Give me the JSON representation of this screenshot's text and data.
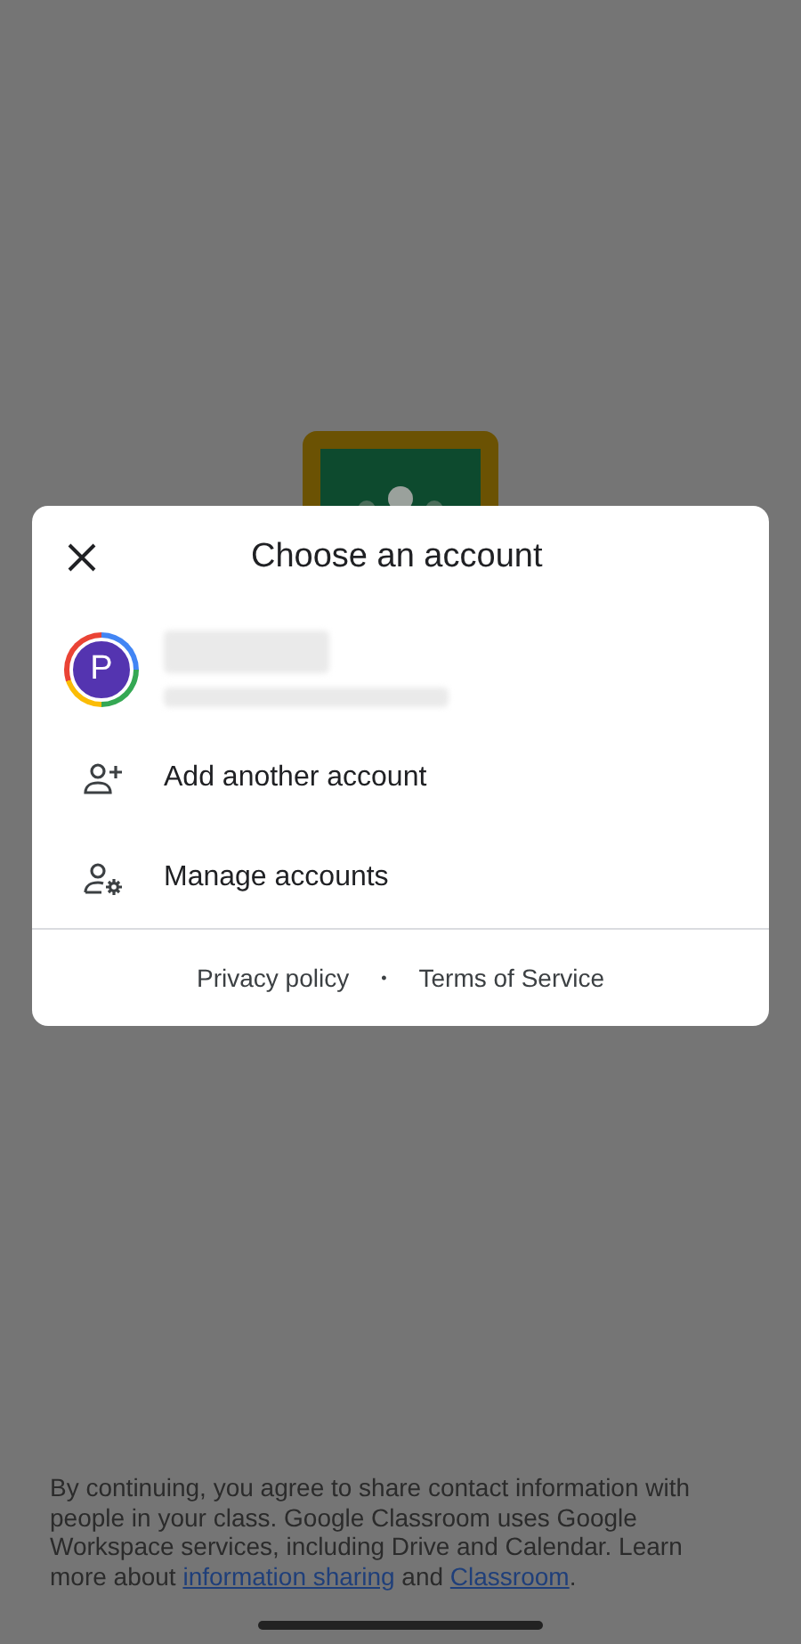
{
  "dialog": {
    "title": "Choose an account",
    "account": {
      "avatar_letter": "P"
    },
    "actions": [
      {
        "kind": "add",
        "label": "Add another account"
      },
      {
        "kind": "manage",
        "label": "Manage accounts"
      }
    ],
    "links": [
      "Privacy policy",
      "Terms of Service"
    ],
    "separator": "•"
  },
  "notice": [
    {
      "kind": "text",
      "text": "By continuing, you agree to share contact information with people in your class. Google Classroom uses Google Workspace services, including Drive and Calendar. Learn more about "
    },
    {
      "kind": "link",
      "text": "information sharing"
    },
    {
      "kind": "text",
      "text": " and "
    },
    {
      "kind": "link",
      "text": "Classroom"
    },
    {
      "kind": "text",
      "text": "."
    }
  ]
}
